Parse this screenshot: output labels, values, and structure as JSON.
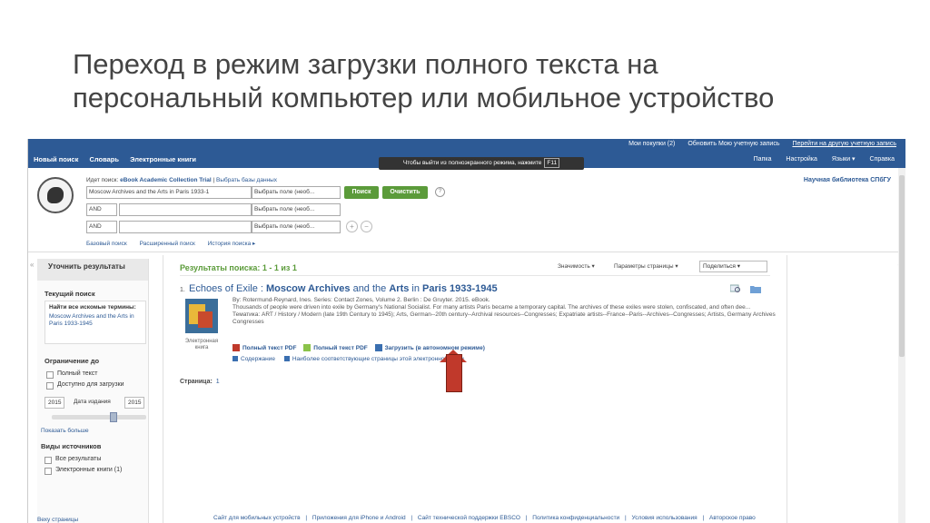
{
  "slide": {
    "title_line1": "Переход в режим загрузки полного текста на",
    "title_line2": "персональный компьютер или мобильное устройство"
  },
  "topbar": {
    "links": [
      "Мои покупки (2)",
      "Обновить Мою учетную запись",
      "Перейти на другую учетную запись"
    ],
    "nav": [
      "Новый поиск",
      "Словарь",
      "Электронные книги"
    ],
    "right": [
      "Папка",
      "Настройка",
      "Языки ▾",
      "Справка"
    ],
    "fullscreen_msg": "Чтобы выйти из полноэкранного режима, нажмите",
    "fullscreen_key": "F11"
  },
  "search": {
    "searching_prefix": "Идет поиск:",
    "database": "eBook Academic Collection Trial",
    "choose_db": "Выбрать базы данных",
    "query": "Moscow Archives and the Arts in Paris 1933-1",
    "field_select": "Выбрать поле (необ...",
    "bool1": "AND",
    "bool2": "AND",
    "search_btn": "Поиск",
    "clear_btn": "Очистить",
    "help": "?",
    "plus": "+",
    "minus": "−",
    "adv_links": [
      "Базовый поиск",
      "Расширенный поиск",
      "История поиска ▸"
    ],
    "library": "Научная библиотека СПбГУ"
  },
  "sidebar": {
    "header": "Уточнить результаты",
    "current_search": "Текущий поиск",
    "found_terms": "Найти все искомые термины:",
    "found_value": "Moscow Archives and the Arts in Paris 1933-1945",
    "limit_to": "Ограничение до",
    "limits": [
      "Полный текст",
      "Доступно для загрузки"
    ],
    "year_from": "2015",
    "year_label": "Дата издания",
    "year_to": "2015",
    "show_more": "Показать больше",
    "source_types": "Виды источников",
    "sources": [
      "Все результаты",
      "Электронные книги (1)"
    ]
  },
  "results": {
    "header": "Результаты поиска: 1 - 1 из 1",
    "relevance": "Значимость ▾",
    "page_options": "Параметры страницы ▾",
    "share": "Поделиться ▾",
    "item_number": "1.",
    "title_a": "Echoes of Exile : ",
    "title_b": "Moscow Archives",
    "title_c": " and the ",
    "title_d": "Arts",
    "title_e": " in ",
    "title_f": "Paris 1933-1945",
    "byline": "By: Rotermund-Reynard, Ines. Series: Contact Zones, Volume 2. Berlin : De Gruyter. 2015. eBook.",
    "abstract": "Thousands of people were driven into exile by Germany's National Socialist. For many artists Paris became a temporary capital. The archives of these exiles were stolen, confiscated, and often dee...",
    "subjects": "Тематика: ART / History / Modern (late 19th Century to 1945); Arts, German--20th century--Archival resources--Congresses; Expatriate artists--France--Paris--Archives--Congresses; Artists, Germany Archives Congresses",
    "cover_label": "Электронная книга",
    "pdf1": "Полный текст PDF",
    "pdf2": "Полный текст PDF",
    "download": "Загрузить (в автономном режиме)",
    "contents": "Содержание",
    "relevant_pages": "Наиболее соответствующие страницы этой электронной книги",
    "pages_label": "Страница:",
    "pages_value": "1"
  },
  "footer": {
    "left": "Веху страницы",
    "items": [
      "Сайт для мобильных устройств",
      "|",
      "Приложения для iPhone и Android",
      "|",
      "Сайт технической поддержки EBSCO",
      "|",
      "Политика конфиденциальности",
      "|",
      "Условия использования",
      "|",
      "Авторское право"
    ]
  },
  "colors": {
    "topbar": "#2d5a95",
    "accent_green": "#5b9b3a",
    "arrow": "#c0392b"
  }
}
